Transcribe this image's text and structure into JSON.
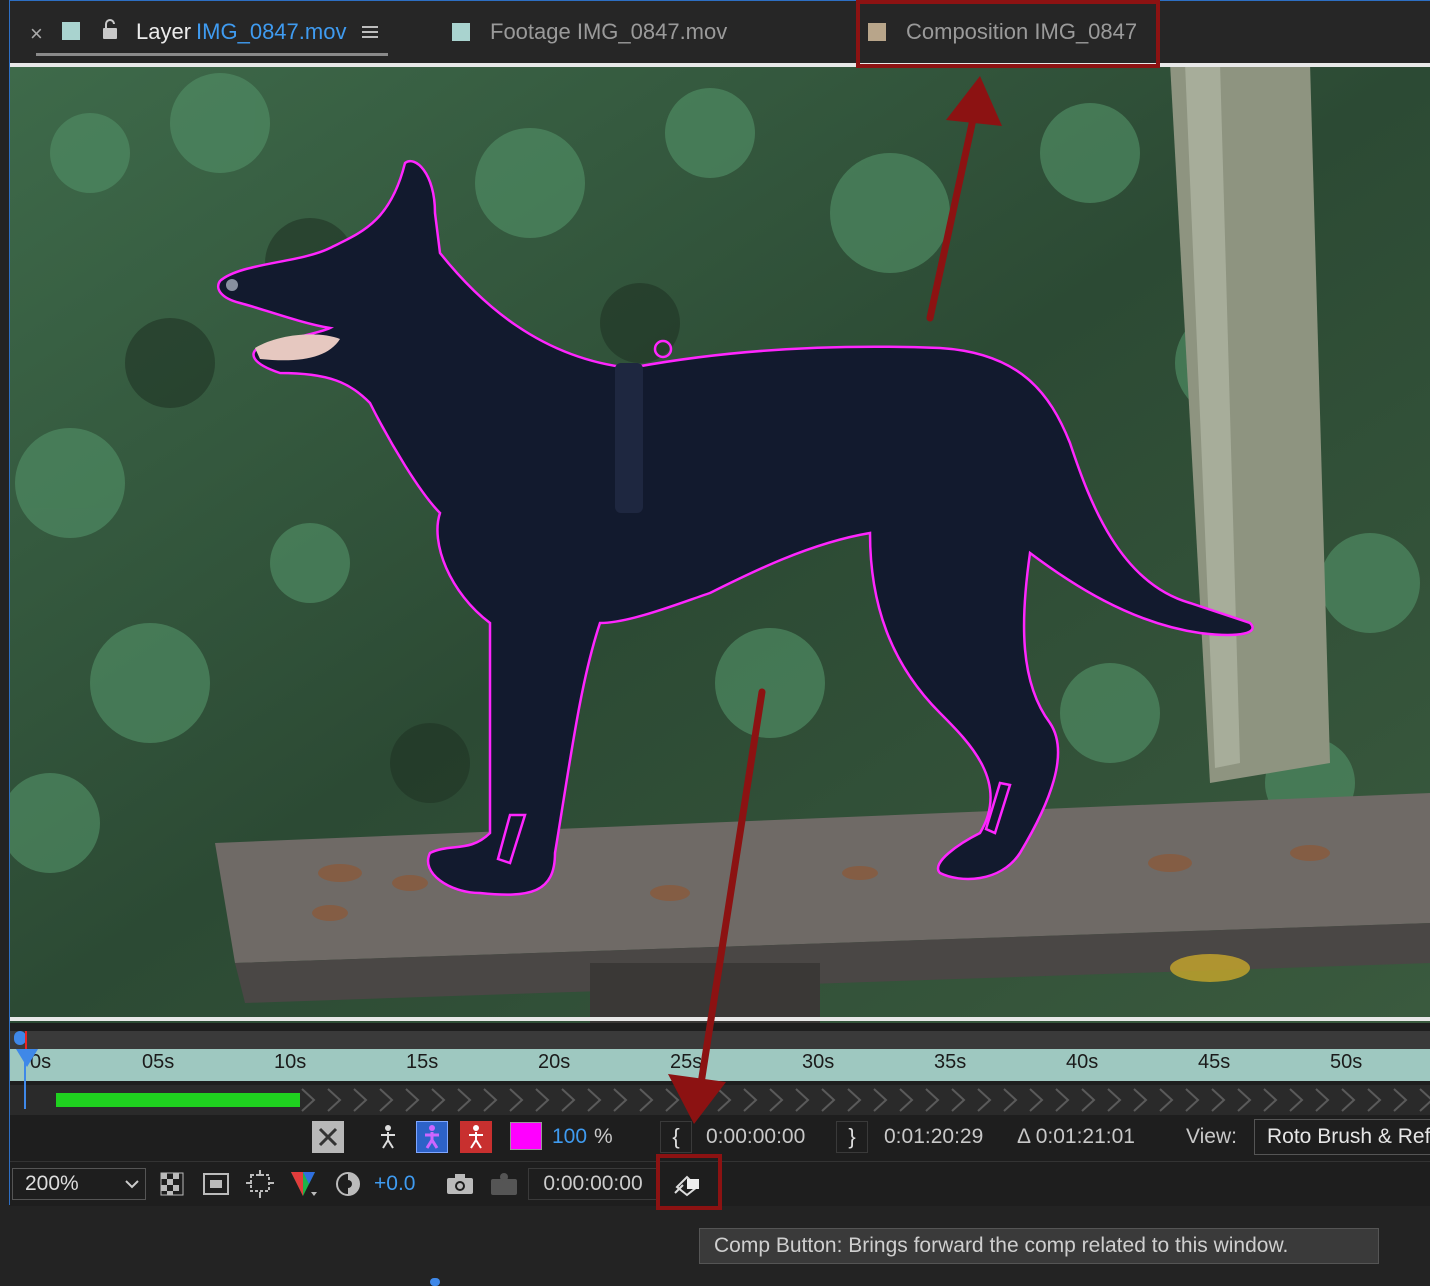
{
  "tabs": {
    "close": "×",
    "layer": {
      "prefix": "Layer",
      "name": "IMG_0847.mov",
      "swatch": "#a9d3cf"
    },
    "footage": {
      "label": "Footage IMG_0847.mov",
      "swatch": "#a9d3cf"
    },
    "composition": {
      "label": "Composition IMG_0847",
      "swatch": "#b8a58a"
    }
  },
  "timeline": {
    "ticks": [
      "0s",
      "05s",
      "10s",
      "15s",
      "20s",
      "25s",
      "30s",
      "35s",
      "40s",
      "45s",
      "50s"
    ]
  },
  "controls": {
    "resolution_pct": "100",
    "pct_sign": "%",
    "in_time": "0:00:00:00",
    "out_time": "0:01:20:29",
    "duration": "Δ 0:01:21:01",
    "view_label": "View:",
    "view_value": "Roto Brush & Refine Edge",
    "zoom": "200%",
    "exposure": "+0.0",
    "current_time": "0:00:00:00"
  },
  "tooltip": "Comp Button: Brings forward the comp related to this window.",
  "colors": {
    "accent_blue": "#3f88e8",
    "roto_outline": "#ff26ff",
    "annotation_red": "#8c1212",
    "ruler": "#9ec8c0",
    "cache_bar": "#1fd11f"
  }
}
